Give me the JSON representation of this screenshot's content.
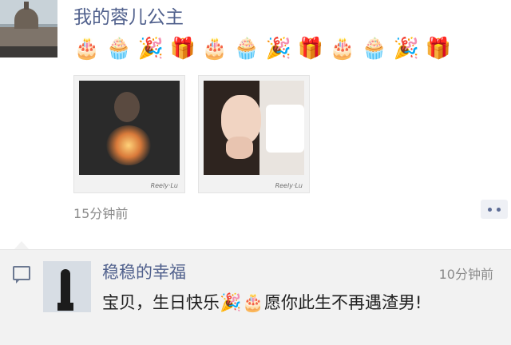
{
  "post": {
    "author_name": "我的蓉儿公主",
    "emojis": [
      {
        "icon": "birthday-cake-icon",
        "glyph": "🎂"
      },
      {
        "icon": "cupcake-icon",
        "glyph": "🧁"
      },
      {
        "icon": "party-popper-icon",
        "glyph": "🎉"
      },
      {
        "icon": "gift-icon",
        "glyph": "🎁"
      },
      {
        "icon": "birthday-cake-icon",
        "glyph": "🎂"
      },
      {
        "icon": "cupcake-icon",
        "glyph": "🧁"
      },
      {
        "icon": "party-popper-icon",
        "glyph": "🎉"
      },
      {
        "icon": "gift-icon",
        "glyph": "🎁"
      },
      {
        "icon": "birthday-cake-icon",
        "glyph": "🎂"
      },
      {
        "icon": "cupcake-icon",
        "glyph": "🧁"
      },
      {
        "icon": "party-popper-icon",
        "glyph": "🎉"
      },
      {
        "icon": "gift-icon",
        "glyph": "🎁"
      }
    ],
    "photos": [
      {
        "signature": "Reely·Lu"
      },
      {
        "signature": "Reely·Lu"
      }
    ],
    "time": "15分钟前"
  },
  "comment": {
    "author_name": "稳稳的幸福",
    "time": "10分钟前",
    "text_part1": "宝贝，生日快乐",
    "emoji1": "🎉",
    "emoji2": "🎂",
    "text_part2": "愿你此生不再遇渣男!"
  },
  "colors": {
    "name_link": "#51618d",
    "meta_gray": "#8a8a8a",
    "comment_bg": "#f2f2f2"
  }
}
